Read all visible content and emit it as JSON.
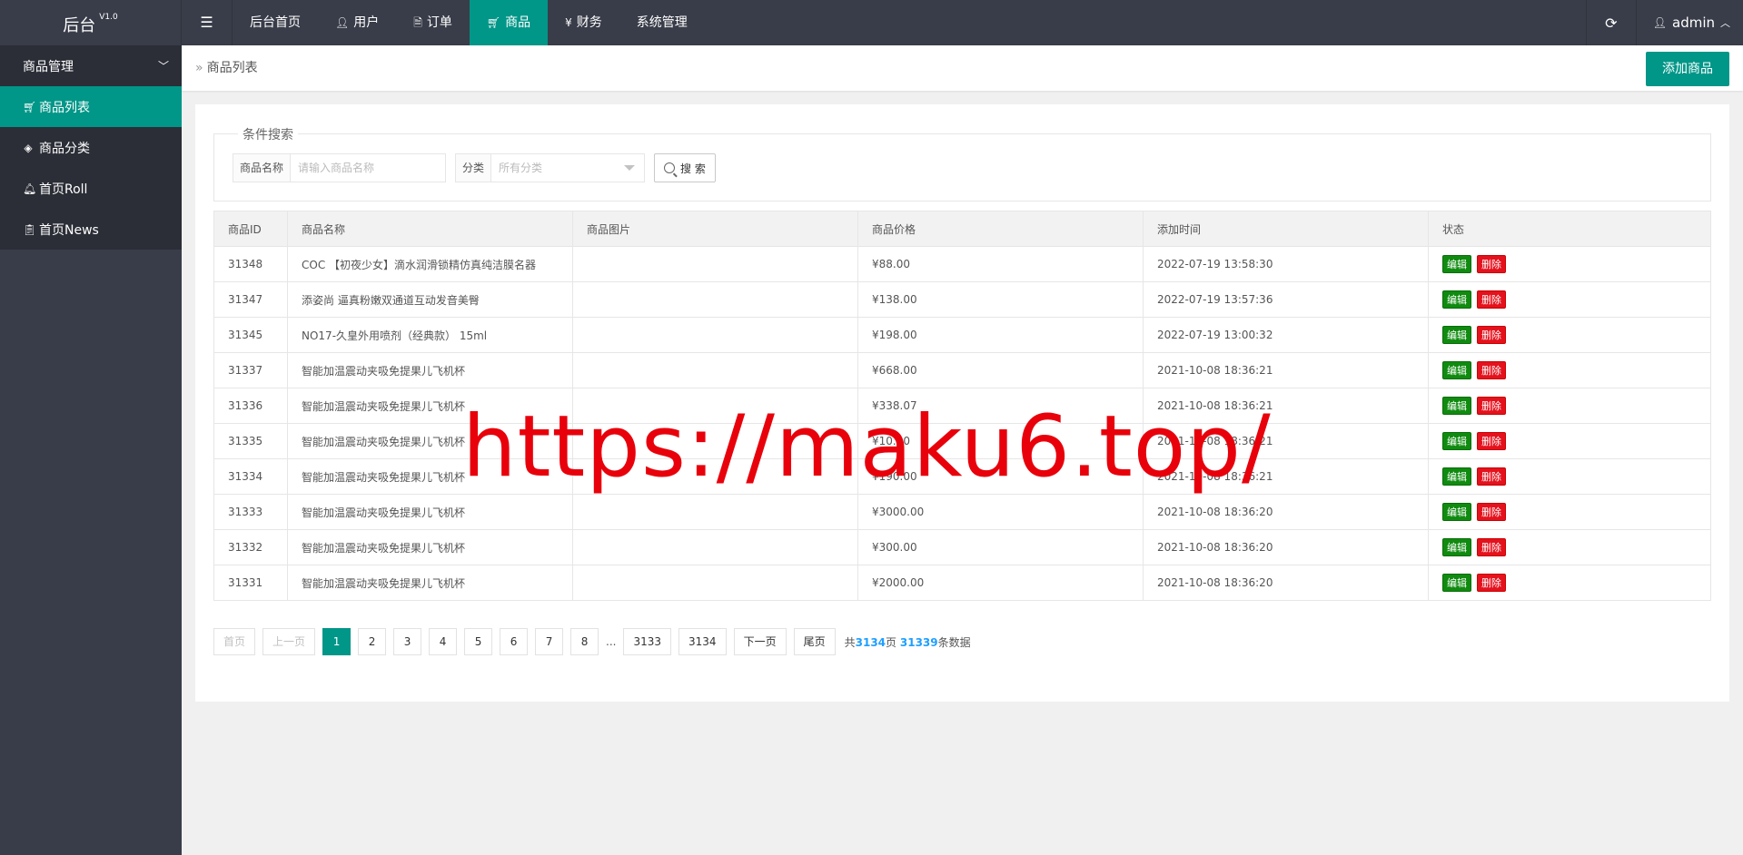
{
  "header": {
    "logo": "后台",
    "version": "V1.0",
    "nav": [
      {
        "label": "后台首页",
        "icon": ""
      },
      {
        "label": "用户",
        "icon": "user-icon"
      },
      {
        "label": "订单",
        "icon": "document-icon"
      },
      {
        "label": "商品",
        "icon": "cart-icon",
        "active": true
      },
      {
        "label": "财务",
        "icon": "yen-icon"
      },
      {
        "label": "系统管理",
        "icon": ""
      }
    ],
    "user": "admin"
  },
  "sidebar": {
    "group": "商品管理",
    "items": [
      {
        "label": "商品列表",
        "icon": "cart-icon",
        "active": true
      },
      {
        "label": "商品分类",
        "icon": "layers-icon"
      },
      {
        "label": "首页Roll",
        "icon": "bell-icon"
      },
      {
        "label": "首页News",
        "icon": "clipboard-icon"
      }
    ]
  },
  "breadcrumb": {
    "current": "商品列表"
  },
  "toolbar": {
    "add_label": "添加商品"
  },
  "search": {
    "legend": "条件搜索",
    "name_label": "商品名称",
    "name_placeholder": "请输入商品名称",
    "category_label": "分类",
    "category_value": "所有分类",
    "button": "搜 索"
  },
  "table": {
    "headers": [
      "商品ID",
      "商品名称",
      "商品图片",
      "商品价格",
      "添加时间",
      "状态"
    ],
    "edit_label": "编辑",
    "delete_label": "删除",
    "rows": [
      {
        "id": "31348",
        "name": "COC 【初夜少女】滴水润滑锁精仿真纯洁膜名器",
        "image": "",
        "price": "¥88.00",
        "time": "2022-07-19 13:58:30"
      },
      {
        "id": "31347",
        "name": "添姿尚 逼真粉嫩双通道互动发音美臀",
        "image": "",
        "price": "¥138.00",
        "time": "2022-07-19 13:57:36"
      },
      {
        "id": "31345",
        "name": "NO17-久皇外用喷剂（经典款） 15ml",
        "image": "",
        "price": "¥198.00",
        "time": "2022-07-19 13:00:32"
      },
      {
        "id": "31337",
        "name": "智能加温震动夹吸免提果儿飞机杯",
        "image": "",
        "price": "¥668.00",
        "time": "2021-10-08 18:36:21"
      },
      {
        "id": "31336",
        "name": "智能加温震动夹吸免提果儿飞机杯",
        "image": "",
        "price": "¥338.07",
        "time": "2021-10-08 18:36:21"
      },
      {
        "id": "31335",
        "name": "智能加温震动夹吸免提果儿飞机杯",
        "image": "",
        "price": "¥10.00",
        "time": "2021-10-08 18:36:21"
      },
      {
        "id": "31334",
        "name": "智能加温震动夹吸免提果儿飞机杯",
        "image": "",
        "price": "¥190.00",
        "time": "2021-10-08 18:36:21"
      },
      {
        "id": "31333",
        "name": "智能加温震动夹吸免提果儿飞机杯",
        "image": "",
        "price": "¥3000.00",
        "time": "2021-10-08 18:36:20"
      },
      {
        "id": "31332",
        "name": "智能加温震动夹吸免提果儿飞机杯",
        "image": "",
        "price": "¥300.00",
        "time": "2021-10-08 18:36:20"
      },
      {
        "id": "31331",
        "name": "智能加温震动夹吸免提果儿飞机杯",
        "image": "",
        "price": "¥2000.00",
        "time": "2021-10-08 18:36:20"
      }
    ]
  },
  "pagination": {
    "first": "首页",
    "prev": "上一页",
    "pages": [
      "1",
      "2",
      "3",
      "4",
      "5",
      "6",
      "7",
      "8"
    ],
    "current": "1",
    "ellipsis": "...",
    "last_pages": [
      "3133",
      "3134"
    ],
    "next": "下一页",
    "last": "尾页",
    "info_prefix": "共",
    "total_pages": "3134",
    "info_pages_suffix": "页",
    "total_records": "31339",
    "info_records_suffix": "条数据"
  },
  "watermark": "https://maku6.top/",
  "colors": {
    "accent": "#009688",
    "topbar": "#393d49",
    "edit": "#108b10",
    "delete": "#e4121d"
  }
}
